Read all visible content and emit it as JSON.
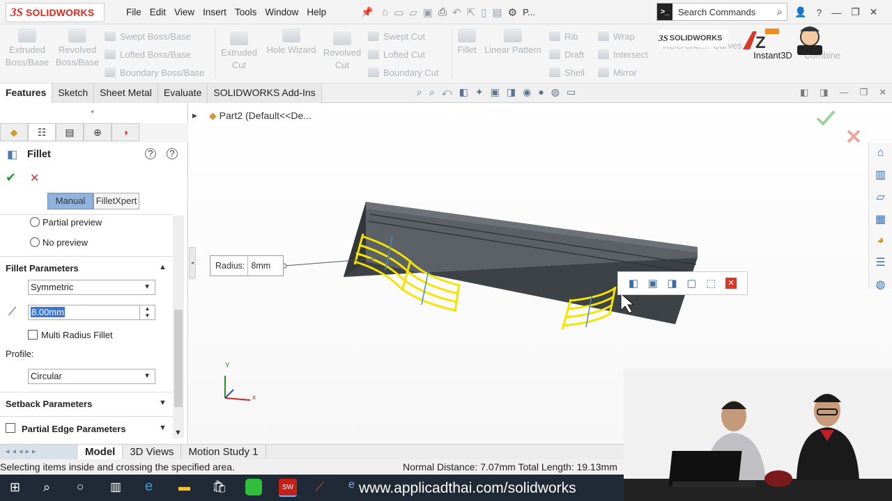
{
  "app": {
    "logo_ds": "3S",
    "logo_name": "SOLIDWORKS"
  },
  "menu": [
    "File",
    "Edit",
    "View",
    "Insert",
    "Tools",
    "Window",
    "Help"
  ],
  "qat_truncated": "P...",
  "search": {
    "placeholder": "Search Commands"
  },
  "ribbon": {
    "extruded_boss": "Extruded\nBoss/Base",
    "revolved_boss": "Revolved\nBoss/Base",
    "swept_boss": "Swept Boss/Base",
    "lofted_boss": "Lofted Boss/Base",
    "boundary_boss": "Boundary Boss/Base",
    "extruded_cut": "Extruded\nCut",
    "hole_wizard": "Hole Wizard",
    "revolved_cut": "Revolved\nCut",
    "swept_cut": "Swept Cut",
    "lofted_cut": "Lofted Cut",
    "boundary_cut": "Boundary Cut",
    "fillet": "Fillet",
    "linear_pattern": "Linear Pattern",
    "rib": "Rib",
    "draft": "Draft",
    "shell": "Shell",
    "wrap": "Wrap",
    "intersect": "Intersect",
    "mirror": "Mirror",
    "reference": "Referenc...",
    "curves": "Curves",
    "instant3d": "Instant3D",
    "combine": "Combine"
  },
  "tabs": [
    "Features",
    "Sketch",
    "Sheet Metal",
    "Evaluate",
    "SOLIDWORKS Add-Ins"
  ],
  "panel": {
    "title": "Fillet",
    "manual": "Manual",
    "filletxpert": "FilletXpert",
    "partial_preview": "Partial preview",
    "no_preview": "No preview",
    "fillet_params": "Fillet Parameters",
    "symmetric": "Symmetric",
    "radius_value": "8.00mm",
    "multi_radius": "Multi Radius Fillet",
    "profile_label": "Profile:",
    "profile_value": "Circular",
    "setback": "Setback Parameters",
    "partial_edge": "Partial Edge Parameters"
  },
  "tree": {
    "part": "Part2  (Default<<De..."
  },
  "callout": {
    "label": "Radius:",
    "value": "8mm"
  },
  "axes": {
    "x": "x",
    "y": "Y"
  },
  "bottom_tabs": [
    "Model",
    "3D Views",
    "Motion Study 1"
  ],
  "status": {
    "left": "Selecting items inside and crossing the specified area.",
    "right": "Normal Distance: 7.07mm Total Length: 19.13mm"
  },
  "taskbar": {
    "url": "www.applicadthai.com/solidworks"
  },
  "colors": {
    "accent": "#2a6fd6",
    "selection": "#f5e400",
    "body": "#454a4f",
    "close": "#d53a2a"
  }
}
